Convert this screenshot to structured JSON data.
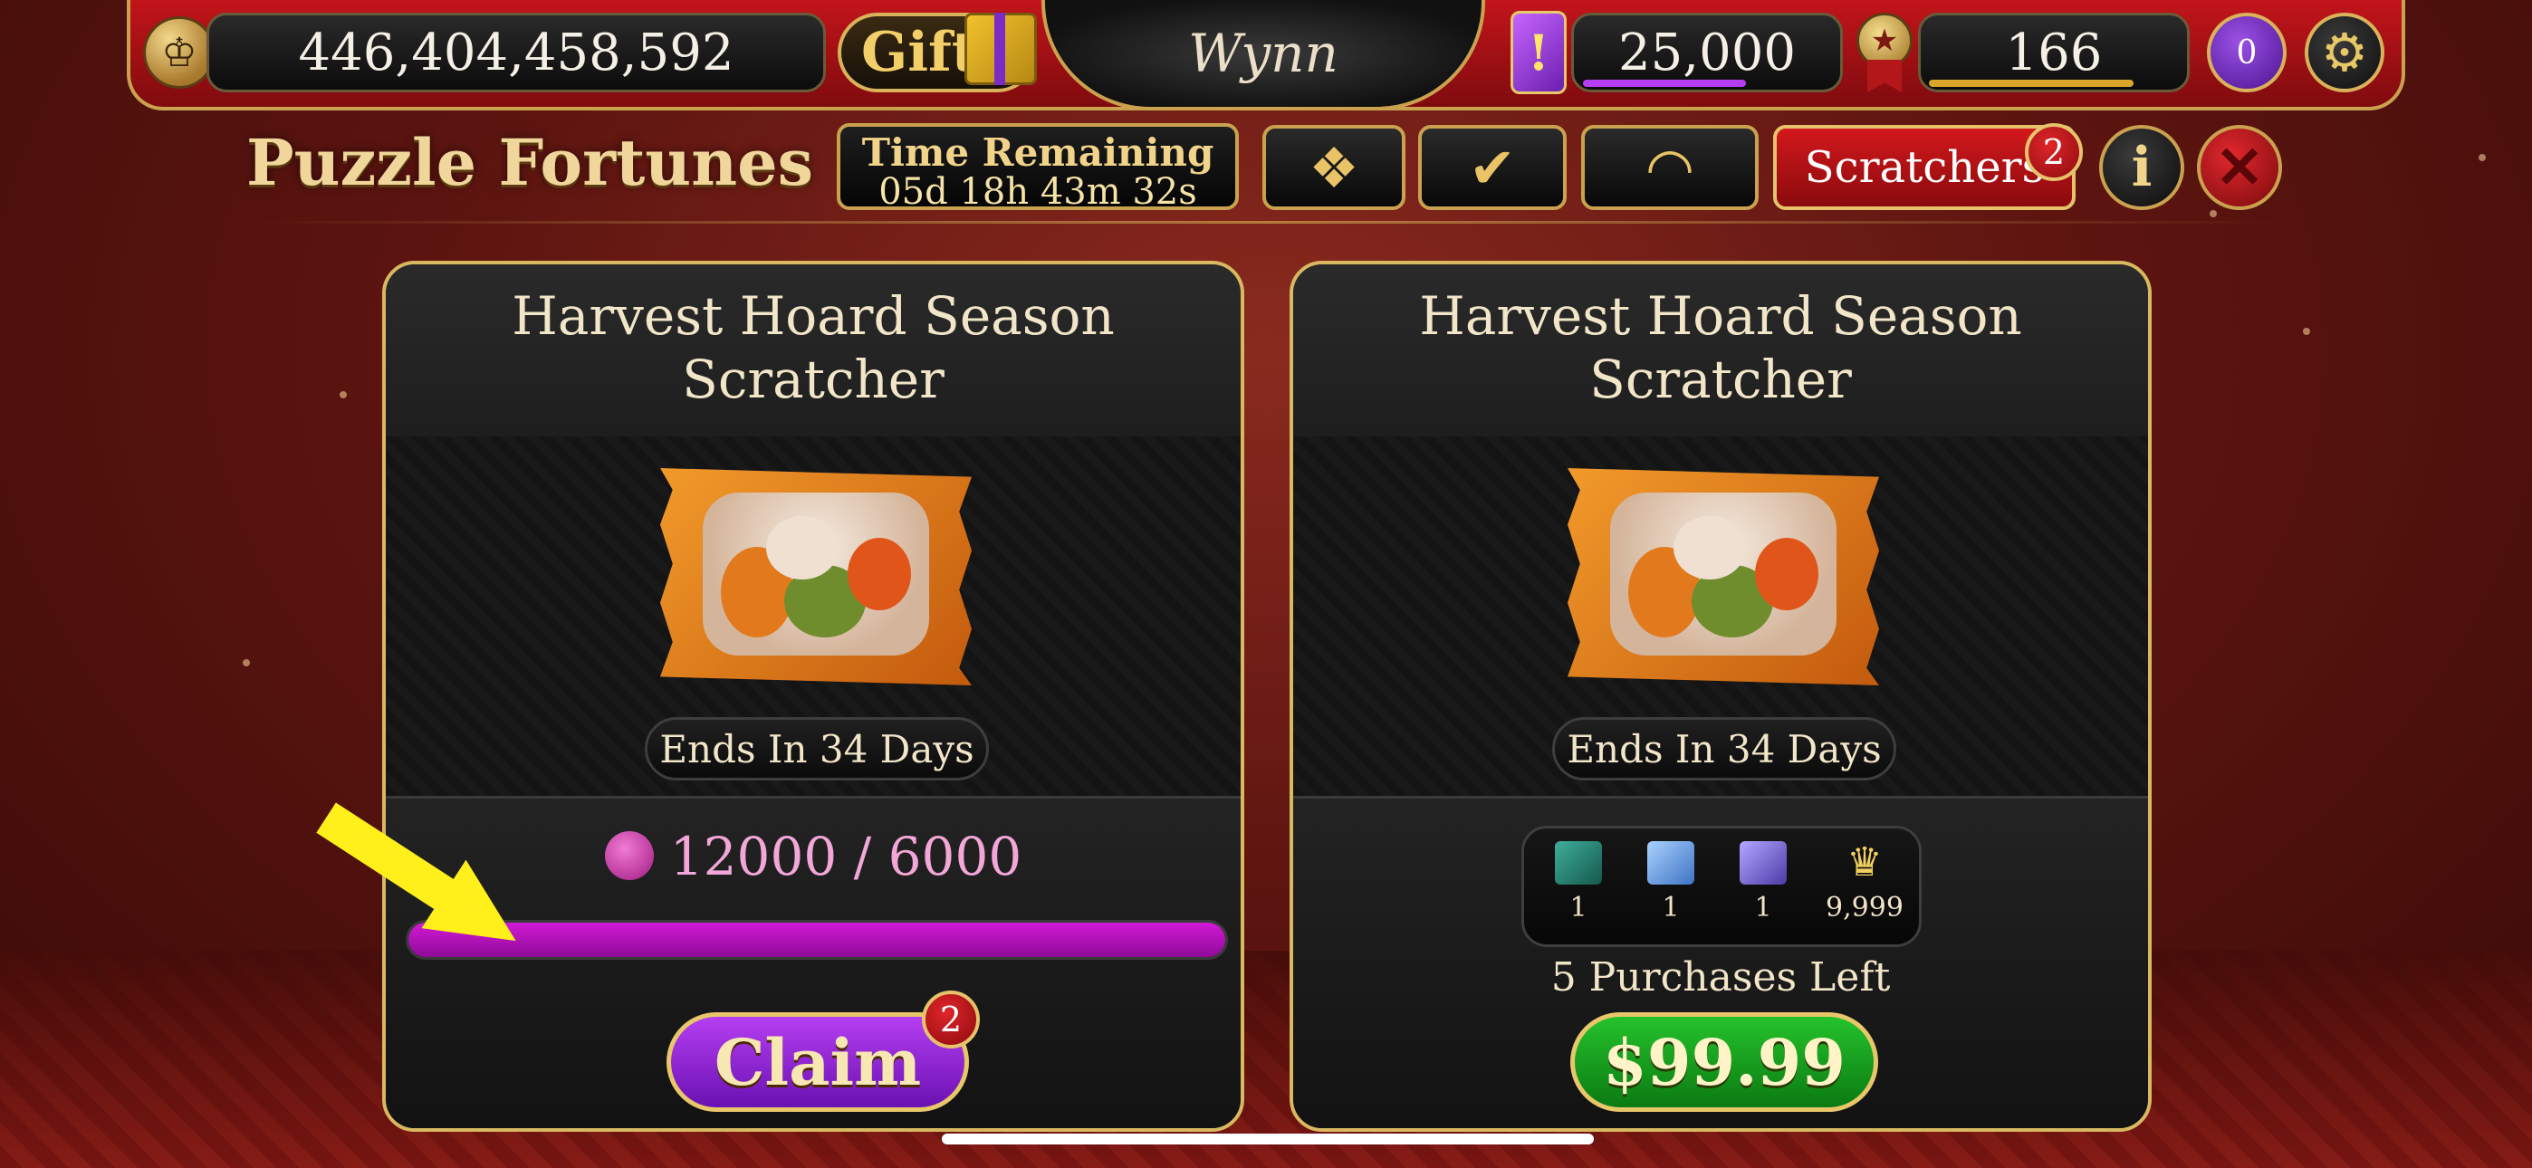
{
  "topbar": {
    "coins": "446,404,458,592",
    "gift_label": "Gift",
    "logo_text": "Wynn",
    "gems": "25,000",
    "level": "166",
    "vip_count": "0",
    "icons": [
      "wynn-coin-icon",
      "gift-box-icon",
      "gem-icon",
      "medal-icon",
      "crown-icon",
      "gear-icon"
    ],
    "gems_bar_color": "#b53ef2",
    "level_bar_color": "#d9a52a"
  },
  "header": {
    "title": "Puzzle Fortunes",
    "timer_label": "Time Remaining",
    "timer_value": "05d 18h 43m 32s",
    "tabs": [
      {
        "icon": "puzzle-piece-icon",
        "glyph": "❖"
      },
      {
        "icon": "checkmark-icon",
        "glyph": "✔"
      },
      {
        "icon": "gauge-icon",
        "glyph": "◠"
      }
    ],
    "scratchers_label": "Scratchers",
    "scratchers_badge": "2",
    "info_glyph": "i",
    "close_glyph": "✕"
  },
  "cards": [
    {
      "title_line1": "Harvest Hoard Season",
      "title_line2": "Scratcher",
      "ends": "Ends In 34 Days",
      "progress_text": "12000 / 6000",
      "progress_fraction": 1.0,
      "claim_label": "Claim",
      "claim_badge": "2"
    },
    {
      "title_line1": "Harvest Hoard Season",
      "title_line2": "Scratcher",
      "ends": "Ends In 34 Days",
      "rewards": [
        {
          "icon": "green-ticket-icon",
          "count": "1"
        },
        {
          "icon": "blue-ticket-icon",
          "count": "1"
        },
        {
          "icon": "purple-ticket-icon",
          "count": "1"
        },
        {
          "icon": "crown-icon",
          "count": "9,999"
        }
      ],
      "purchases_left": "5 Purchases Left",
      "price": "$99.99"
    }
  ],
  "colors": {
    "accent_gold": "#caa24f",
    "progress_magenta": "#d21ad6",
    "claim_purple": "#8a22d2",
    "buy_green": "#1aa322",
    "arrow_yellow": "#ffef1a"
  }
}
